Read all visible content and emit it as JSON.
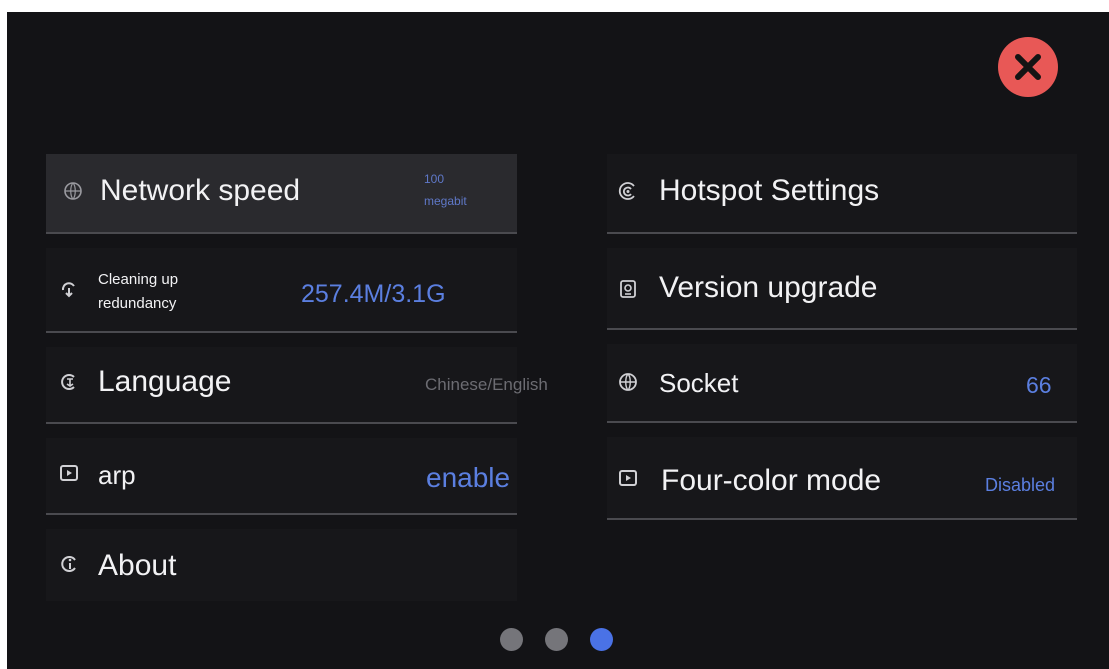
{
  "colors": {
    "accent": "#5b7fe0",
    "close": "#e85856",
    "background": "#131316"
  },
  "close_button": {
    "icon": "close-icon"
  },
  "left_items": [
    {
      "label": "Network speed",
      "value_line1": "100",
      "value_line2": "megabit",
      "icon": "globe-icon"
    },
    {
      "label_line1": "Cleaning up",
      "label_line2": "redundancy",
      "value": "257.4M/3.1G",
      "icon": "clean-icon"
    },
    {
      "label": "Language",
      "value": "Chinese/English",
      "icon": "language-icon"
    },
    {
      "label": "arp",
      "value": "enable",
      "icon": "play-box-icon"
    },
    {
      "label": "About",
      "icon": "info-icon"
    }
  ],
  "right_items": [
    {
      "label": "Hotspot Settings",
      "icon": "hotspot-icon"
    },
    {
      "label": "Version upgrade",
      "icon": "upgrade-icon"
    },
    {
      "label": "Socket",
      "value": "66",
      "icon": "socket-icon"
    },
    {
      "label": "Four-color mode",
      "value": "Disabled",
      "icon": "play-box-icon"
    }
  ],
  "pagination": {
    "pages": 3,
    "active": 3
  }
}
